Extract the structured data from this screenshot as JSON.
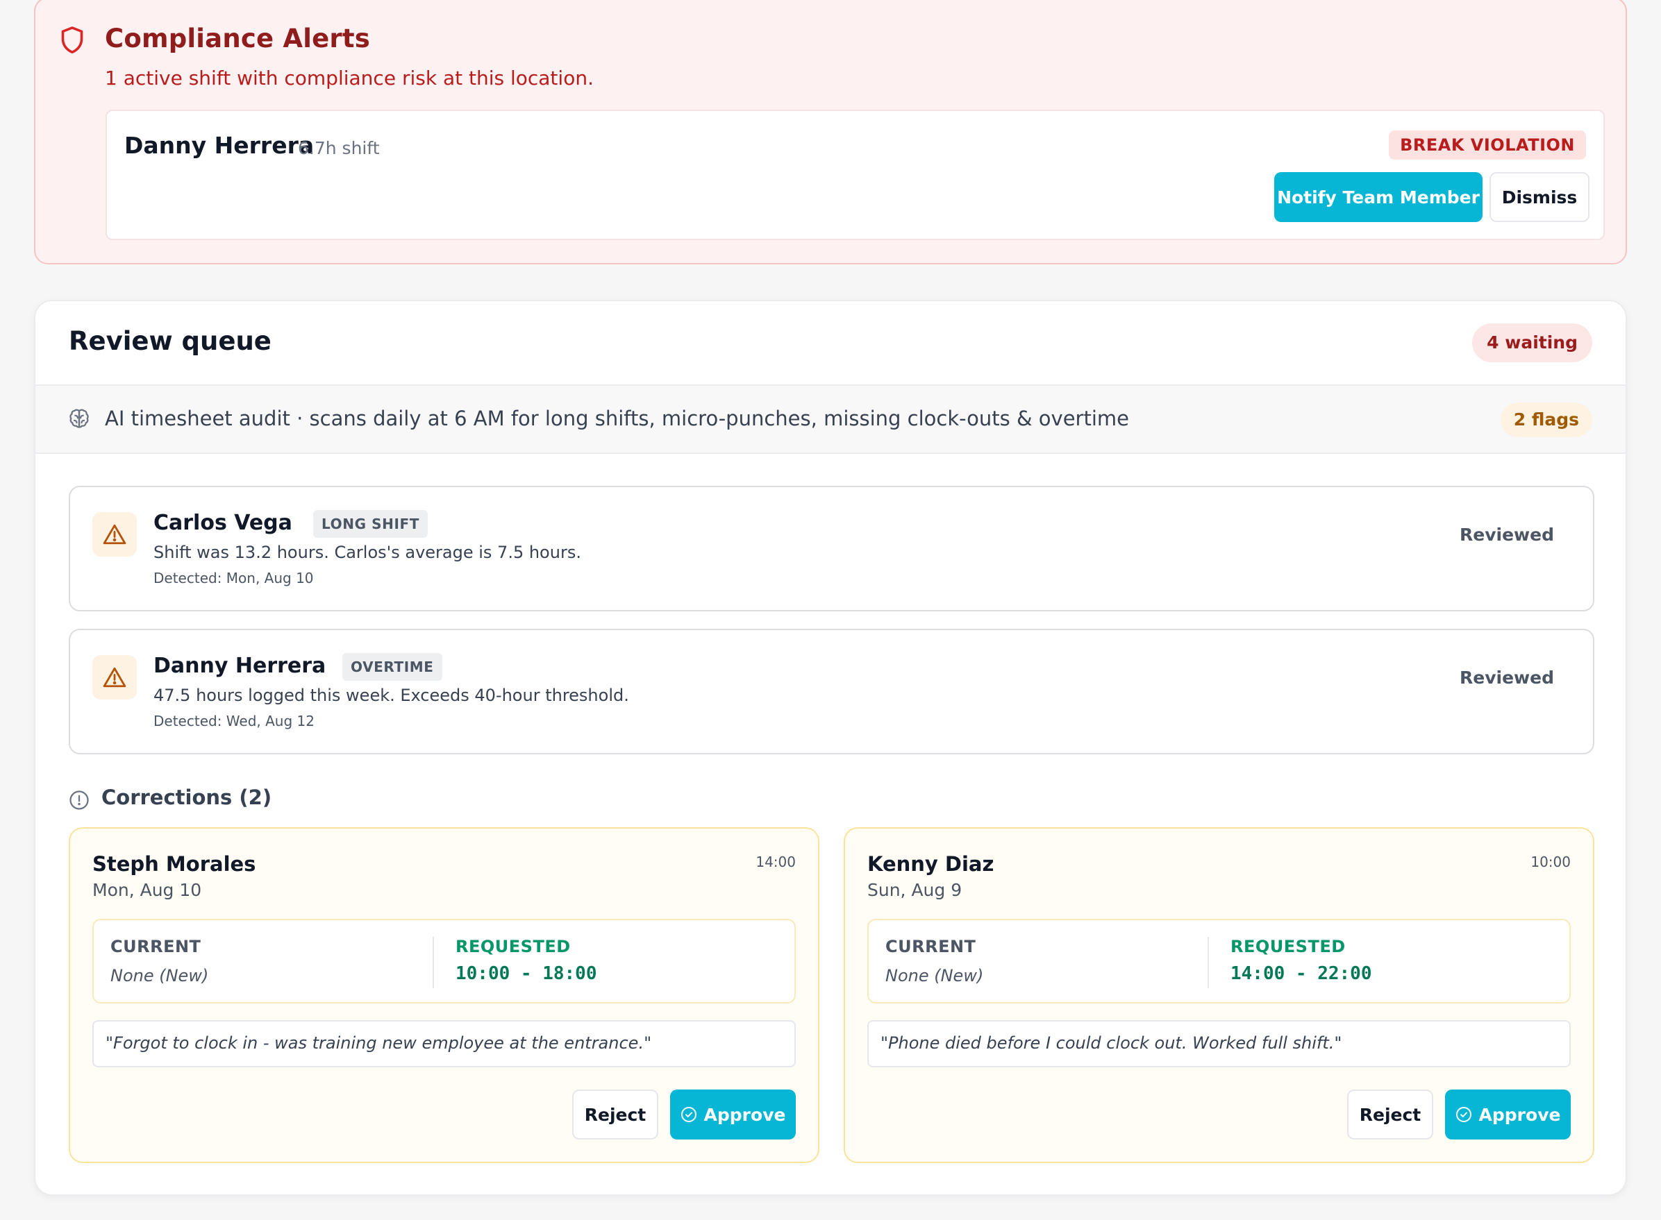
{
  "compliance": {
    "title": "Compliance Alerts",
    "subtitle": "1 active shift with compliance risk at this location.",
    "alert": {
      "name": "Danny Herrera",
      "shift": "6.7h shift",
      "badge": "BREAK VIOLATION",
      "notify_label": "Notify Team Member",
      "dismiss_label": "Dismiss"
    }
  },
  "queue": {
    "title": "Review queue",
    "waiting": "4 waiting",
    "audit": {
      "text": "AI timesheet audit · scans daily at 6 AM for long shifts, micro-punches, missing clock-outs & overtime",
      "flags": "2 flags"
    },
    "flags": [
      {
        "name": "Carlos Vega",
        "tag": "LONG SHIFT",
        "description": "Shift was 13.2 hours. Carlos's average is 7.5 hours.",
        "detected": "Detected: Mon, Aug 10",
        "status": "Reviewed"
      },
      {
        "name": "Danny Herrera",
        "tag": "OVERTIME",
        "description": "47.5 hours logged this week. Exceeds 40-hour threshold.",
        "detected": "Detected: Wed, Aug 12",
        "status": "Reviewed"
      }
    ],
    "corrections_title": "Corrections (2)",
    "corrections": [
      {
        "name": "Steph Morales",
        "date": "Mon, Aug 10",
        "time": "14:00",
        "current_label": "CURRENT",
        "current_value": "None (New)",
        "requested_label": "REQUESTED",
        "requested_value": "10:00 - 18:00",
        "reason": "\"Forgot to clock in - was training new employee at the entrance.\"",
        "reject_label": "Reject",
        "approve_label": "Approve"
      },
      {
        "name": "Kenny Diaz",
        "date": "Sun, Aug 9",
        "time": "10:00",
        "current_label": "CURRENT",
        "current_value": "None (New)",
        "requested_label": "REQUESTED",
        "requested_value": "14:00 - 22:00",
        "reason": "\"Phone died before I could clock out. Worked full shift.\"",
        "reject_label": "Reject",
        "approve_label": "Approve"
      }
    ]
  },
  "colors": {
    "accent": "#06b6d4",
    "alert_red": "#b91c1c",
    "warning_amber": "#d97706",
    "success_green": "#059669"
  },
  "icons": {
    "alert": "shield-icon",
    "audit": "brain-icon",
    "flag": "warning-triangle-icon",
    "corrections": "alert-circle-icon",
    "approve": "check-circle-icon"
  }
}
